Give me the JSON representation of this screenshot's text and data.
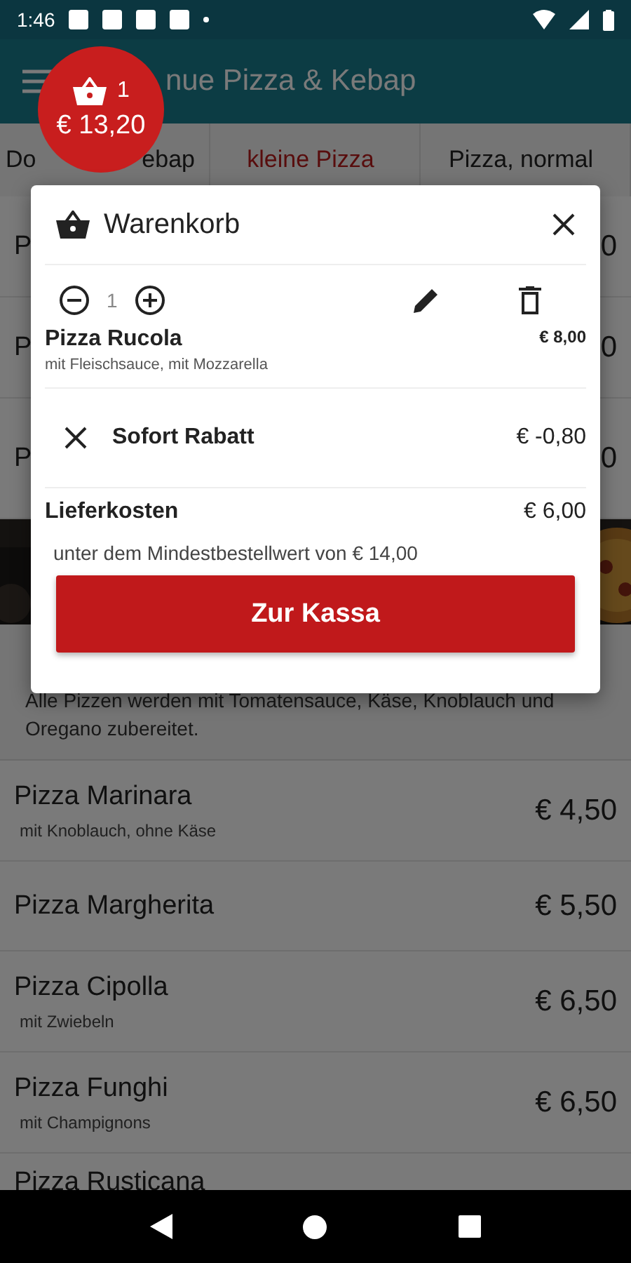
{
  "status_bar": {
    "time": "1:46"
  },
  "app_bar": {
    "title": "nue Pizza & Kebap"
  },
  "cart_badge": {
    "count": "1",
    "total": "€ 13,20"
  },
  "tabs": [
    {
      "label_start": "Do",
      "label_end": "ebap",
      "selected": false
    },
    {
      "label": "kleine Pizza",
      "selected": true
    },
    {
      "label": "Pizza, normal",
      "selected": false
    }
  ],
  "covered_rows": [
    {
      "name": "P",
      "price": "0"
    },
    {
      "name": "P",
      "price": "0"
    },
    {
      "name": "P",
      "price": "0"
    }
  ],
  "section": {
    "description": "Alle Pizzen werden mit Tomatensauce, Käse, Knoblauch und Oregano zubereitet."
  },
  "menu_items": [
    {
      "name": "Pizza Marinara",
      "subtitle": "mit Knoblauch, ohne Käse",
      "price": "€ 4,50"
    },
    {
      "name": "Pizza Margherita",
      "price": "€ 5,50"
    },
    {
      "name": "Pizza Cipolla",
      "subtitle": "mit Zwiebeln",
      "price": "€ 6,50"
    },
    {
      "name": "Pizza Funghi",
      "subtitle": "mit Champignons",
      "price": "€ 6,50"
    },
    {
      "name": "Pizza Rusticana"
    }
  ],
  "cart": {
    "title": "Warenkorb",
    "items": [
      {
        "quantity": "1",
        "name": "Pizza Rucola",
        "extras": "mit Fleischsauce, mit Mozzarella",
        "price": "€ 8,00"
      }
    ],
    "discount": {
      "label": "Sofort Rabatt",
      "amount": "€ -0,80"
    },
    "delivery": {
      "label": "Lieferkosten",
      "amount": "€ 6,00",
      "note": "unter dem Mindestbestellwert von € 14,00"
    },
    "checkout_button": "Zur Kassa"
  }
}
